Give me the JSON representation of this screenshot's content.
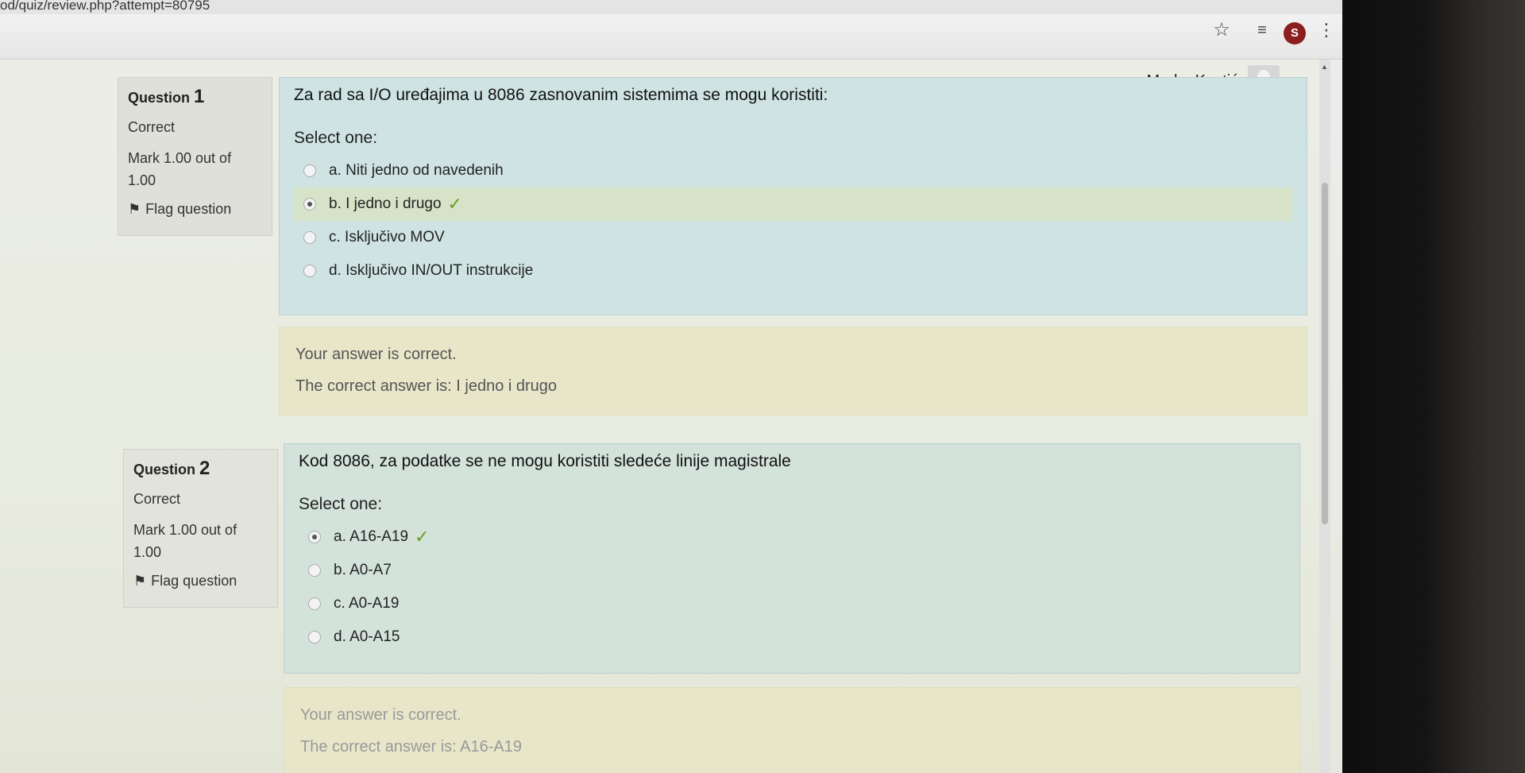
{
  "browser": {
    "url_fragment": "od/quiz/review.php?attempt=80795",
    "icons": [
      "bookmark-star-icon",
      "reading-list-icon",
      "extension-icon",
      "kebab-menu-icon"
    ]
  },
  "user": {
    "name": "Marko Kostić"
  },
  "questions": [
    {
      "label": "Question",
      "number": "1",
      "state": "Correct",
      "grade_line1": "Mark 1.00 out of",
      "grade_line2": "1.00",
      "flag": "Flag question",
      "text": "Za rad sa I/O uređajima u 8086 zasnovanim sistemima se mogu koristiti:",
      "prompt": "Select one:",
      "answers": [
        {
          "label": "a. Niti jedno od navedenih",
          "selected": false,
          "correct": false
        },
        {
          "label": "b. I jedno i drugo",
          "selected": true,
          "correct": true
        },
        {
          "label": "c. Isključivo MOV",
          "selected": false,
          "correct": false
        },
        {
          "label": "d. Isključivo IN/OUT instrukcije",
          "selected": false,
          "correct": false
        }
      ],
      "feedback": "Your answer is correct.",
      "right_answer": "The correct answer is: I jedno i drugo"
    },
    {
      "label": "Question",
      "number": "2",
      "state": "Correct",
      "grade_line1": "Mark 1.00 out of",
      "grade_line2": "1.00",
      "flag": "Flag question",
      "text": "Kod 8086, za podatke se ne mogu koristiti sledeće linije magistrale",
      "prompt": "Select one:",
      "answers": [
        {
          "label": "a. A16-A19",
          "selected": true,
          "correct": true
        },
        {
          "label": "b. A0-A7",
          "selected": false,
          "correct": false
        },
        {
          "label": "c. A0-A19",
          "selected": false,
          "correct": false
        },
        {
          "label": "d. A0-A15",
          "selected": false,
          "correct": false
        }
      ],
      "feedback": "Your answer is correct.",
      "right_answer": "The correct answer is: A16-A19"
    }
  ],
  "colors": {
    "formulation_bg": "#cfe3e3",
    "outcome_bg": "#e7e6c9",
    "info_bg": "#dfe0da",
    "correct_tick": "#6aa021",
    "selected_row": "#d7e3c8"
  }
}
